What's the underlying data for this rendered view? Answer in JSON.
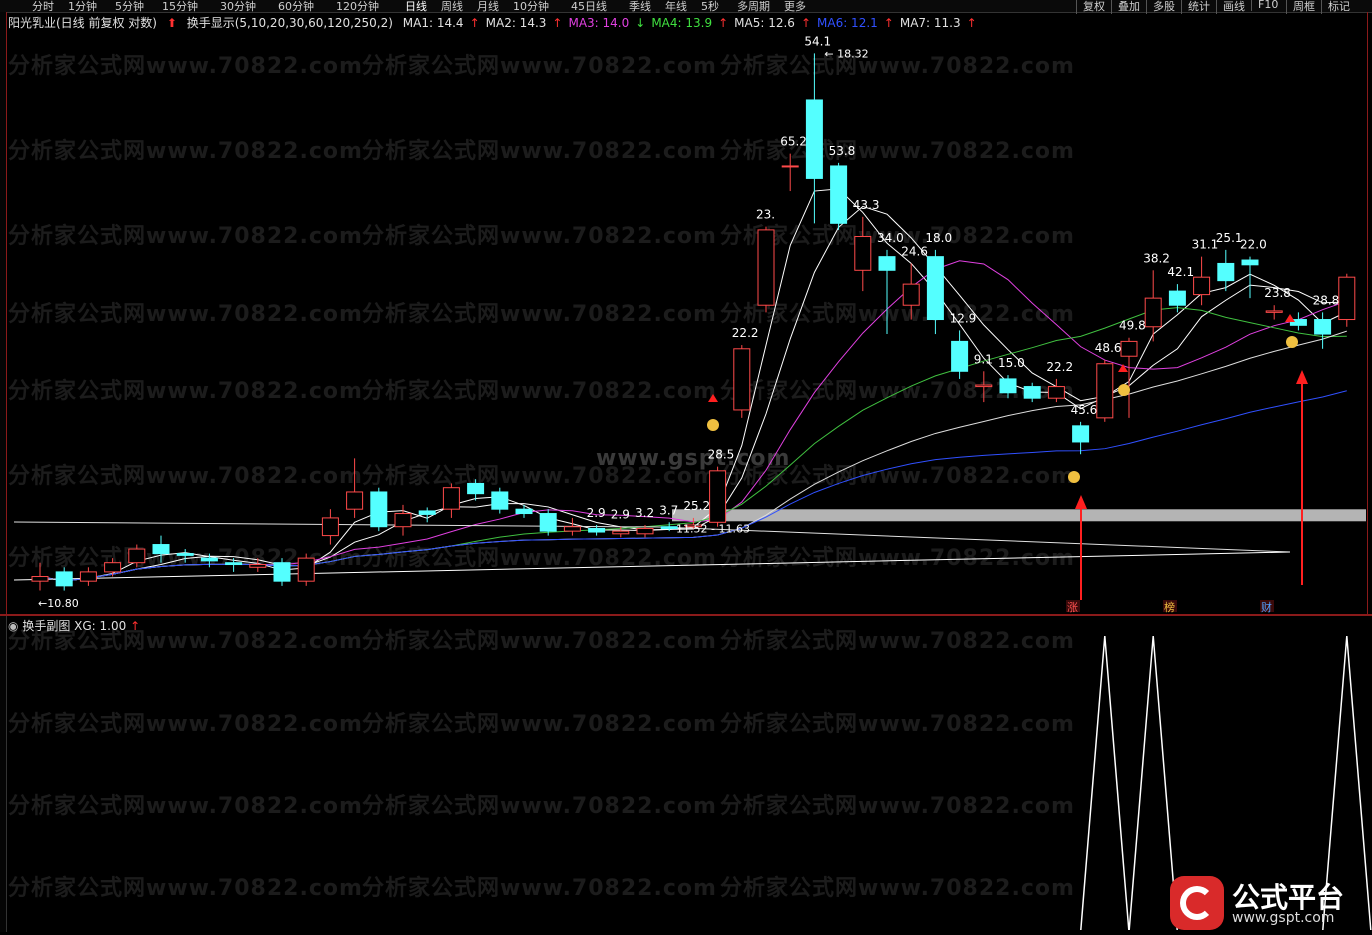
{
  "toolbar": {
    "timeframes": [
      "分时",
      "1分钟",
      "5分钟",
      "15分钟",
      "30分钟",
      "60分钟",
      "120分钟",
      "日线",
      "周线",
      "月线",
      "10分钟",
      "45日线",
      "季线",
      "年线",
      "5秒",
      "多周期",
      "更多"
    ],
    "right_buttons": [
      "复权",
      "叠加",
      "多股",
      "统计",
      "画线",
      "F10",
      "周框",
      "标记"
    ]
  },
  "main_legend": {
    "stock": "阳光乳业(日线 前复权 对数)",
    "indicator": "换手显示(5,10,20,30,60,120,250,2)",
    "ma": [
      {
        "label": "MA1: 14.4",
        "color": "#ffffff",
        "arrow": "↑"
      },
      {
        "label": "MA2: 14.3",
        "color": "#ffffff",
        "arrow": "↑"
      },
      {
        "label": "MA3: 14.0",
        "color": "#e040e0",
        "arrow": "↓"
      },
      {
        "label": "MA4: 13.9",
        "color": "#40e040",
        "arrow": "↑"
      },
      {
        "label": "MA5: 12.6",
        "color": "#ffffff",
        "arrow": "↑"
      },
      {
        "label": "MA6: 12.1",
        "color": "#3050ff",
        "arrow": "↑"
      },
      {
        "label": "MA7: 11.3",
        "color": "#ffffff",
        "arrow": "↑"
      }
    ]
  },
  "sub_legend": {
    "title": "换手副图",
    "xg": "XG: 1.00"
  },
  "watermark": "分析家公式网www.70822.com",
  "center_watermark": "www.gspt.com",
  "price_labels": {
    "high": "18.32",
    "low": "10.80",
    "range": "11.52 - 11.63"
  },
  "turnover_labels": [
    "2.9",
    "2.9",
    "3.2",
    "3.7",
    "25.2",
    "28.5",
    "22.2",
    "23.",
    "65.2",
    "54.1",
    "53.8",
    "43.3",
    "34.0",
    "24.6",
    "18.0",
    "12.9",
    "9.1",
    "15.0",
    "22.2",
    "45.6",
    "48.6",
    "49.8",
    "38.2",
    "42.1",
    "31.1",
    "25.1",
    "22.0",
    "23.8",
    "28.8"
  ],
  "signal_labels": [
    "涨",
    "榜",
    "财"
  ],
  "logo": {
    "title": "公式平台",
    "url": "www.gspt.com"
  },
  "colors": {
    "up": "#ff4a4a",
    "down": "#54ffff",
    "axis": "#8b1a1a",
    "bg": "#000000"
  },
  "chart_data": {
    "type": "candlestick",
    "candles": [
      {
        "o": 10.9,
        "c": 10.95,
        "h": 11.1,
        "l": 10.8
      },
      {
        "o": 11.0,
        "c": 10.85,
        "h": 11.05,
        "l": 10.8
      },
      {
        "o": 10.9,
        "c": 11.0,
        "h": 11.05,
        "l": 10.85
      },
      {
        "o": 11.0,
        "c": 11.1,
        "h": 11.15,
        "l": 10.95
      },
      {
        "o": 11.1,
        "c": 11.25,
        "h": 11.3,
        "l": 11.05
      },
      {
        "o": 11.3,
        "c": 11.2,
        "h": 11.4,
        "l": 11.1
      },
      {
        "o": 11.2,
        "c": 11.18,
        "h": 11.25,
        "l": 11.1
      },
      {
        "o": 11.15,
        "c": 11.12,
        "h": 11.2,
        "l": 11.05
      },
      {
        "o": 11.1,
        "c": 11.08,
        "h": 11.15,
        "l": 11.0
      },
      {
        "o": 11.05,
        "c": 11.08,
        "h": 11.15,
        "l": 11.0
      },
      {
        "o": 11.1,
        "c": 10.9,
        "h": 11.15,
        "l": 10.85
      },
      {
        "o": 10.9,
        "c": 11.15,
        "h": 11.2,
        "l": 10.85
      },
      {
        "o": 11.4,
        "c": 11.6,
        "h": 11.7,
        "l": 11.3
      },
      {
        "o": 11.7,
        "c": 11.9,
        "h": 12.3,
        "l": 11.6
      },
      {
        "o": 11.9,
        "c": 11.5,
        "h": 11.95,
        "l": 11.45
      },
      {
        "o": 11.5,
        "c": 11.65,
        "h": 11.75,
        "l": 11.4
      },
      {
        "o": 11.68,
        "c": 11.64,
        "h": 11.72,
        "l": 11.55
      },
      {
        "o": 11.7,
        "c": 11.95,
        "h": 12.0,
        "l": 11.6
      },
      {
        "o": 12.0,
        "c": 11.88,
        "h": 12.05,
        "l": 11.8
      },
      {
        "o": 11.9,
        "c": 11.7,
        "h": 11.95,
        "l": 11.65
      },
      {
        "o": 11.7,
        "c": 11.65,
        "h": 11.75,
        "l": 11.6
      },
      {
        "o": 11.65,
        "c": 11.45,
        "h": 11.7,
        "l": 11.4
      },
      {
        "o": 11.45,
        "c": 11.5,
        "h": 11.6,
        "l": 11.4
      },
      {
        "o": 11.48,
        "c": 11.44,
        "h": 11.52,
        "l": 11.4
      },
      {
        "o": 11.42,
        "c": 11.45,
        "h": 11.5,
        "l": 11.38
      },
      {
        "o": 11.42,
        "c": 11.48,
        "h": 11.52,
        "l": 11.38
      },
      {
        "o": 11.5,
        "c": 11.48,
        "h": 11.55,
        "l": 11.45
      },
      {
        "o": 11.5,
        "c": 11.52,
        "h": 11.6,
        "l": 11.48
      },
      {
        "o": 11.55,
        "c": 12.15,
        "h": 12.2,
        "l": 11.5
      },
      {
        "o": 12.9,
        "c": 13.7,
        "h": 13.75,
        "l": 12.8
      },
      {
        "o": 14.3,
        "c": 15.4,
        "h": 15.45,
        "l": 14.2
      },
      {
        "o": 16.4,
        "c": 16.4,
        "h": 16.6,
        "l": 16.0
      },
      {
        "o": 17.5,
        "c": 16.2,
        "h": 18.32,
        "l": 15.5
      },
      {
        "o": 16.4,
        "c": 15.5,
        "h": 16.45,
        "l": 15.4
      },
      {
        "o": 14.8,
        "c": 15.3,
        "h": 15.6,
        "l": 14.5
      },
      {
        "o": 15.0,
        "c": 14.8,
        "h": 15.1,
        "l": 13.9
      },
      {
        "o": 14.3,
        "c": 14.6,
        "h": 14.9,
        "l": 14.1
      },
      {
        "o": 15.0,
        "c": 14.1,
        "h": 15.1,
        "l": 13.9
      },
      {
        "o": 13.8,
        "c": 13.4,
        "h": 13.95,
        "l": 13.3
      },
      {
        "o": 13.2,
        "c": 13.22,
        "h": 13.4,
        "l": 13.0
      },
      {
        "o": 13.3,
        "c": 13.12,
        "h": 13.35,
        "l": 13.05
      },
      {
        "o": 13.2,
        "c": 13.05,
        "h": 13.25,
        "l": 13.0
      },
      {
        "o": 13.05,
        "c": 13.2,
        "h": 13.3,
        "l": 13.0
      },
      {
        "o": 12.7,
        "c": 12.5,
        "h": 12.75,
        "l": 12.35
      },
      {
        "o": 12.8,
        "c": 13.5,
        "h": 13.55,
        "l": 12.75
      },
      {
        "o": 13.6,
        "c": 13.8,
        "h": 13.85,
        "l": 12.8
      },
      {
        "o": 14.0,
        "c": 14.4,
        "h": 14.8,
        "l": 13.8
      },
      {
        "o": 14.5,
        "c": 14.3,
        "h": 14.6,
        "l": 14.2
      },
      {
        "o": 14.45,
        "c": 14.7,
        "h": 15.0,
        "l": 14.3
      },
      {
        "o": 14.9,
        "c": 14.65,
        "h": 15.1,
        "l": 14.5
      },
      {
        "o": 14.95,
        "c": 14.88,
        "h": 15.0,
        "l": 14.4
      },
      {
        "o": 14.2,
        "c": 14.22,
        "h": 14.3,
        "l": 14.1
      },
      {
        "o": 14.1,
        "c": 14.02,
        "h": 14.2,
        "l": 13.95
      },
      {
        "o": 14.1,
        "c": 13.9,
        "h": 14.2,
        "l": 13.7
      },
      {
        "o": 14.1,
        "c": 14.7,
        "h": 14.75,
        "l": 14.0
      }
    ],
    "xg_signal": [
      0,
      0,
      0,
      0,
      0,
      0,
      0,
      0,
      0,
      0,
      0,
      0,
      0,
      0,
      0,
      0,
      0,
      0,
      0,
      0,
      0,
      0,
      0,
      0,
      0,
      0,
      0,
      0,
      0,
      0,
      0,
      0,
      0,
      0,
      0,
      0,
      0,
      0,
      0,
      0,
      0,
      0,
      0,
      0,
      1,
      0,
      1,
      0,
      0,
      0,
      0,
      0,
      0,
      0,
      1
    ]
  }
}
